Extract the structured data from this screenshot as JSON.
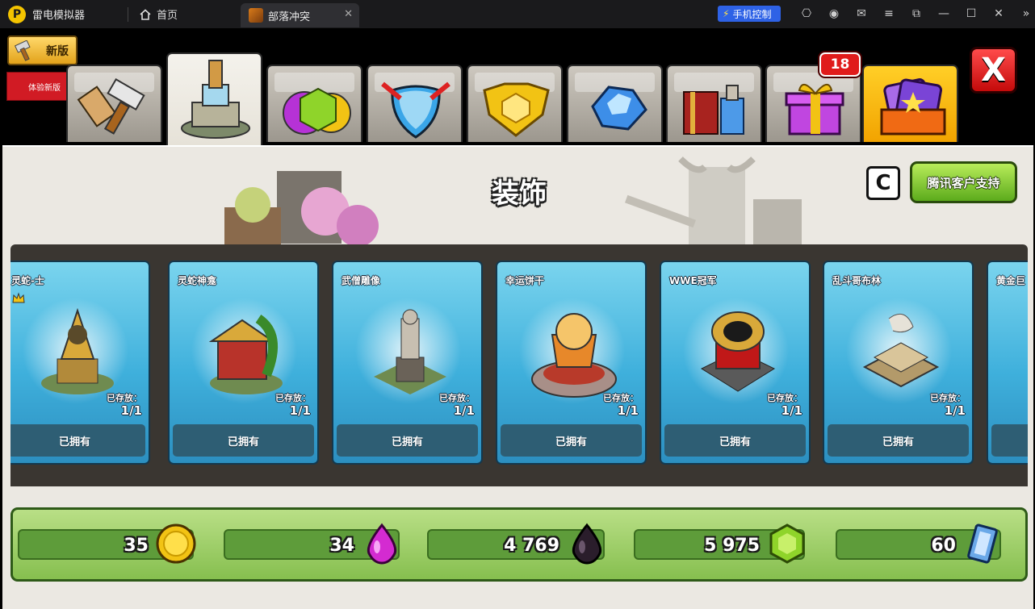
{
  "emulator": {
    "app_title": "雷电模拟器",
    "home_tab": "首页",
    "game_tab": "部落冲突",
    "phone_control": "手机控制"
  },
  "game": {
    "new_version_label": "新版",
    "experience_label": "体验新版",
    "notification_count": "18",
    "close_label": "X",
    "panel_title": "装饰",
    "c_button_label": "C",
    "support_button_label": "腾讯客户支持",
    "stored_label": "已存放：",
    "owned_label": "已拥有",
    "cards": [
      {
        "name": "灵蛇-士",
        "count": "1/1"
      },
      {
        "name": "灵蛇神龛",
        "count": "1/1"
      },
      {
        "name": "武僧雕像",
        "count": "1/1"
      },
      {
        "name": "幸运饼干",
        "count": "1/1"
      },
      {
        "name": "WWE冠军",
        "count": "1/1"
      },
      {
        "name": "乱斗哥布林",
        "count": "1/1"
      },
      {
        "name": "黄金巨",
        "count": ""
      }
    ],
    "resources": {
      "gold": "35",
      "elixir": "34",
      "dark_elixir": "4 769",
      "gems": "5 975",
      "tickets": "60"
    }
  },
  "colors": {
    "gold": "#f2c314",
    "elixir": "#d42bd1",
    "dark_elixir": "#2a1d2b",
    "gem": "#8fd42a",
    "ticket": "#6aa8e8",
    "accent_blue": "#2e62e6"
  }
}
